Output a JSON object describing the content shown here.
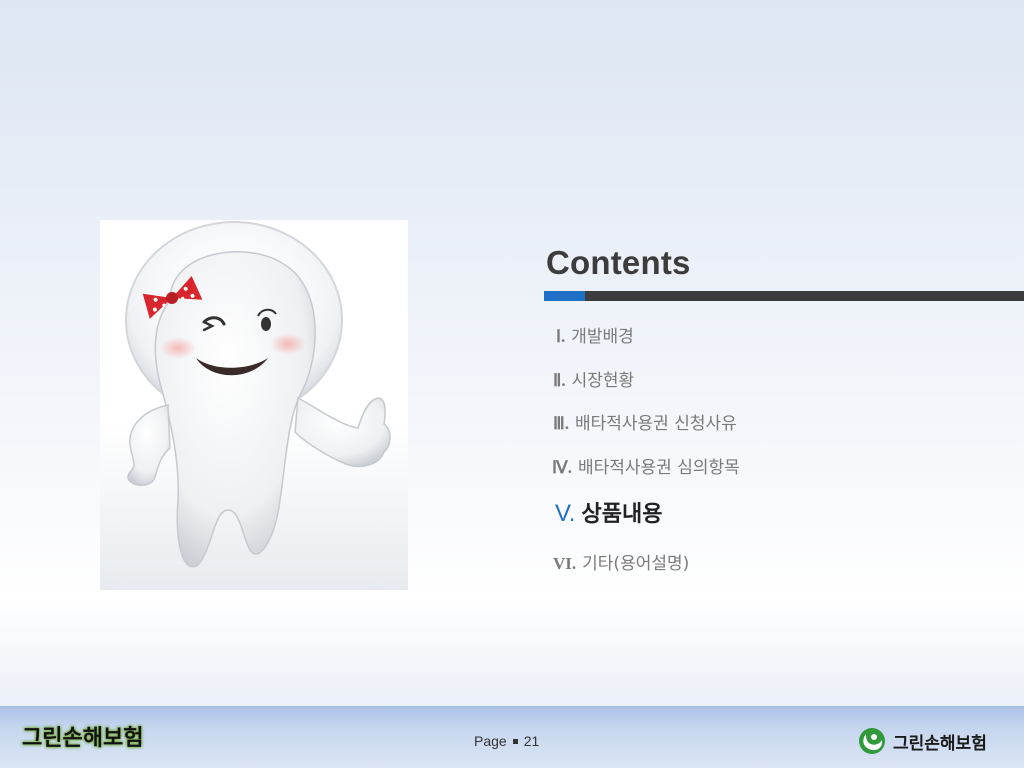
{
  "slide": {
    "title": "Contents",
    "accent_color": "#1f6fc4",
    "bar_color": "#3c3c3c"
  },
  "toc": [
    {
      "num": "Ⅰ.",
      "label": "개발배경",
      "active": false
    },
    {
      "num": "Ⅱ.",
      "label": "시장현황",
      "active": false
    },
    {
      "num": "Ⅲ.",
      "label": "배타적사용권 신청사유",
      "active": false
    },
    {
      "num": "Ⅳ.",
      "label": "배타적사용권 심의항목",
      "active": false
    },
    {
      "num": "V.",
      "label": "상품내용",
      "active": true
    },
    {
      "num": "VI.",
      "label": "기타(용어설명)",
      "active": false
    }
  ],
  "footer": {
    "left_brand": "그린손해보험",
    "page_label": "Page",
    "page_number": "21",
    "logo_text": "그린손해보험",
    "logo_color": "#2e9a3a"
  },
  "mascot": {
    "icon": "tooth-mascot-icon",
    "bow_color": "#d8262c"
  }
}
